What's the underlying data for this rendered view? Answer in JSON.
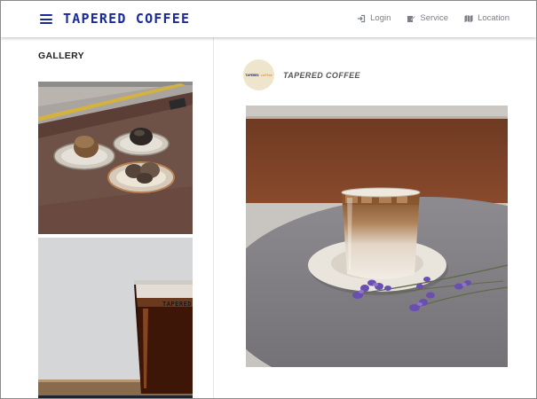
{
  "header": {
    "brand": "TAPERED COFFEE",
    "nav": [
      {
        "label": "Login",
        "icon": "login-icon"
      },
      {
        "label": "Service",
        "icon": "edit-icon"
      },
      {
        "label": "Location",
        "icon": "map-icon"
      }
    ]
  },
  "gallery": {
    "title": "GALLERY"
  },
  "post": {
    "account_name": "TAPERED COFFEE",
    "avatar_text_main": "TAPERED",
    "avatar_text_accent": "coffee"
  },
  "colors": {
    "brand": "#1a2a9c",
    "nav_text": "#7b7f87",
    "accent": "#e09a2c"
  }
}
